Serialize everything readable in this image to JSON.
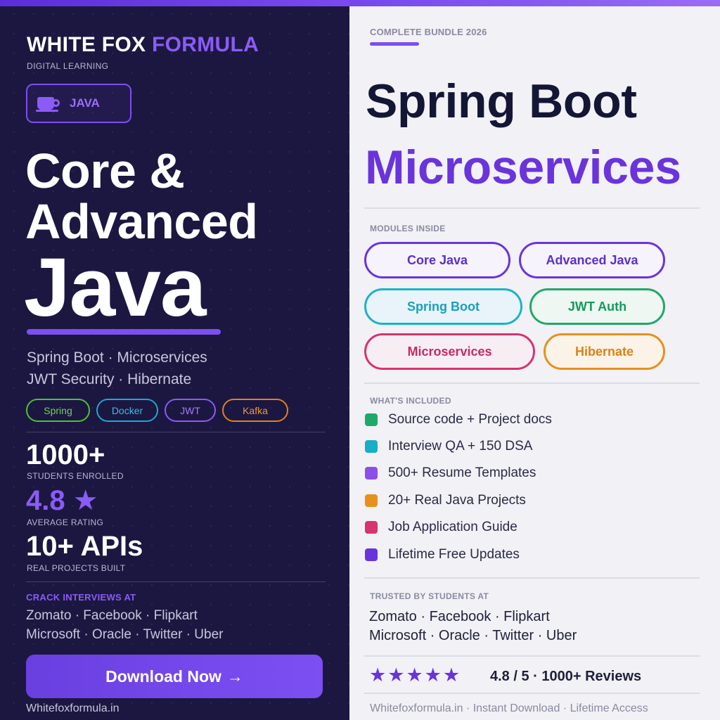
{
  "colors": {
    "left_bg": "#1c1740",
    "accent_purple": "#7b4ff0",
    "right_bg": "#f1f1f6"
  },
  "left": {
    "brand": {
      "part1": "WHITE FOX",
      "part2": "FORMULA",
      "sub": "DIGITAL LEARNING"
    },
    "badge": {
      "icon": "coffee-cup-icon",
      "label": "JAVA"
    },
    "headline": {
      "line1": "Core &",
      "line2": "Advanced",
      "line3": "Java"
    },
    "subtitle": {
      "line1": "Spring Boot · Microservices",
      "line2": "JWT Security · Hibernate"
    },
    "tags": [
      "Spring",
      "Docker",
      "JWT",
      "Kafka"
    ],
    "stats": [
      {
        "value": "1000+",
        "label": "STUDENTS ENROLLED"
      },
      {
        "value": "4.8 ★",
        "label": "AVERAGE RATING"
      },
      {
        "value": "10+ APIs",
        "label": "REAL PROJECTS BUILT"
      }
    ],
    "crack": {
      "title": "CRACK INTERVIEWS AT",
      "line1": "Zomato  ·  Facebook  ·  Flipkart",
      "line2": "Microsoft  ·  Oracle  ·  Twitter  ·  Uber"
    },
    "download": {
      "label": "Download Now",
      "arrow": "→"
    },
    "site": "Whitefoxformula.in"
  },
  "right": {
    "bundle": "COMPLETE BUNDLE 2026",
    "headline": {
      "line1": "Spring Boot",
      "line2": "Microservices"
    },
    "modules_title": "MODULES INSIDE",
    "modules": [
      "Core Java",
      "Advanced Java",
      "Spring Boot",
      "JWT Auth",
      "Microservices",
      "Hibernate"
    ],
    "included_title": "WHAT'S INCLUDED",
    "included": [
      {
        "text": "Source code + Project docs",
        "color": "#1ea86a"
      },
      {
        "text": "Interview QA + 150 DSA",
        "color": "#17aec8"
      },
      {
        "text": "500+ Resume Templates",
        "color": "#8a4fe8"
      },
      {
        "text": "20+ Real Java Projects",
        "color": "#e8901c"
      },
      {
        "text": "Job Application Guide",
        "color": "#d6336f"
      },
      {
        "text": "Lifetime Free Updates",
        "color": "#6a34dc"
      }
    ],
    "trusted_title": "TRUSTED BY STUDENTS AT",
    "trusted": {
      "line1": "Zomato · Facebook · Flipkart",
      "line2": "Microsoft · Oracle · Twitter  · Uber"
    },
    "rating": {
      "stars": 5,
      "text": "4.8 / 5 · 1000+ Reviews"
    },
    "footer": "Whitefoxformula.in  ·  Instant Download  ·  Lifetime Access"
  }
}
